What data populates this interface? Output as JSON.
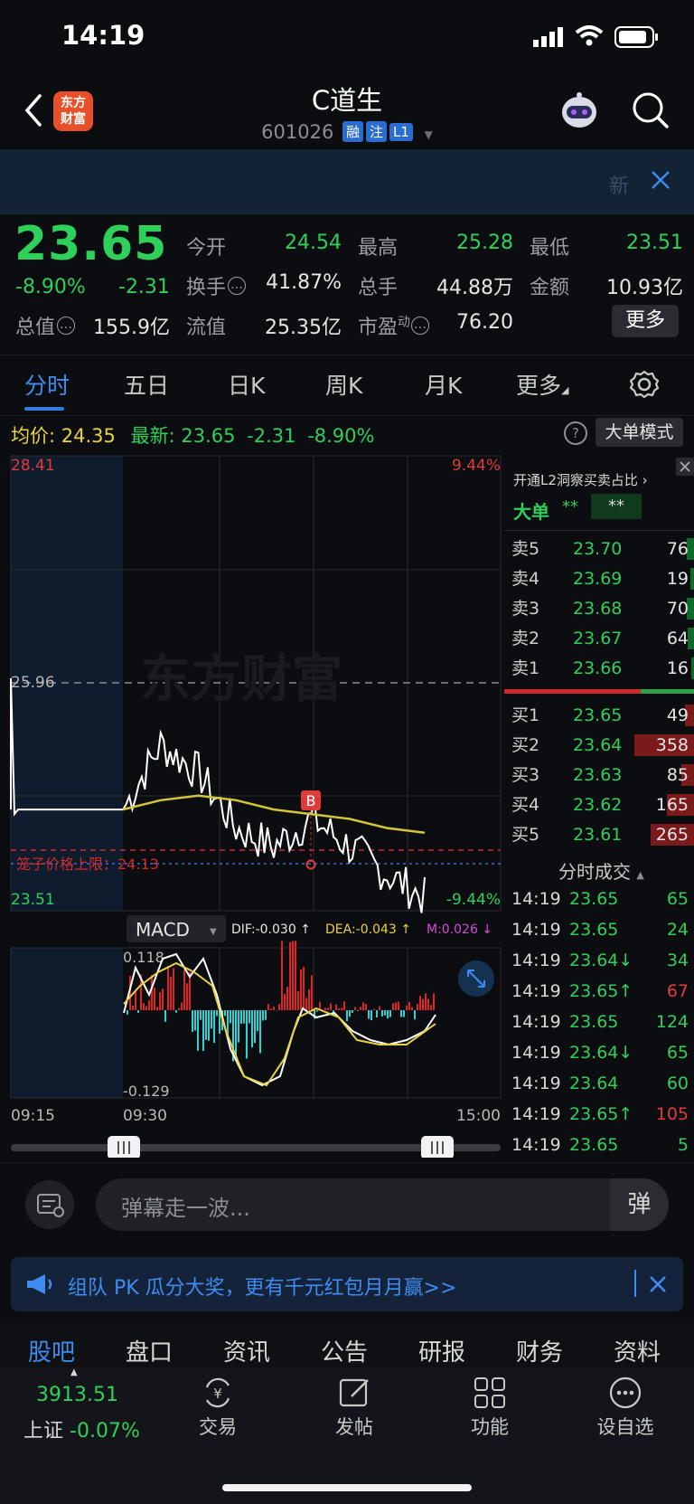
{
  "status_bar": {
    "time": "14:19"
  },
  "header": {
    "logo_text": "东方财富",
    "title": "C道生",
    "code": "601026",
    "tags": [
      "融",
      "注",
      "L1"
    ]
  },
  "banner": {
    "text": "新"
  },
  "quote": {
    "price": "23.65",
    "pct": "-8.90%",
    "change": "-2.31",
    "open_label": "今开",
    "open": "24.54",
    "high_label": "最高",
    "high": "25.28",
    "low_label": "最低",
    "low": "23.51",
    "turnover_label": "换手",
    "turnover": "41.87%",
    "volume_label": "总手",
    "volume": "44.88万",
    "amount_label": "金额",
    "amount": "10.93亿",
    "mktcap_label": "总值",
    "mktcap": "155.9亿",
    "float_label": "流值",
    "float": "25.35亿",
    "pe_label": "市盈",
    "pe_sup": "动",
    "pe": "76.20",
    "more": "更多"
  },
  "tabs": [
    "分时",
    "五日",
    "日K",
    "周K",
    "月K",
    "更多"
  ],
  "info": {
    "avg_label": "均价:",
    "avg": "24.35",
    "last_label": "最新:",
    "last": "23.65",
    "chg": "-2.31",
    "pct": "-8.90%",
    "big_mode": "大单模式",
    "help": "?"
  },
  "chart": {
    "y_max": "28.41",
    "y_mid": "25.96",
    "y_min": "23.51",
    "pct_max": "9.44%",
    "pct_min": "-9.44%",
    "watermark": "东方财富",
    "limit_label": "笼子价格上限：24.13",
    "marker": "B",
    "macd_label": "MACD",
    "dif": "DIF:-0.030 ↑",
    "dea": "DEA:-0.043 ↑",
    "m": "M:0.026 ↓",
    "macd_max": "0.118",
    "macd_min": "-0.129",
    "t_start": "09:15",
    "t_open": "09:30",
    "t_end": "15:00",
    "colors": {
      "price": "#ffffff",
      "avg": "#d4c43a",
      "up": "#e02424",
      "down": "#2ad4d4"
    }
  },
  "chart_data": {
    "type": "line",
    "x": [
      "09:30",
      "10:00",
      "10:30",
      "11:00",
      "11:30",
      "13:00",
      "13:30",
      "14:00",
      "14:19"
    ],
    "series": [
      {
        "name": "最新",
        "values": [
          24.6,
          25.3,
          25.0,
          24.4,
          24.2,
          24.5,
          24.2,
          23.9,
          23.65
        ]
      },
      {
        "name": "均价",
        "values": [
          24.6,
          24.7,
          24.75,
          24.7,
          24.6,
          24.55,
          24.5,
          24.4,
          24.35
        ]
      }
    ],
    "ylim": [
      23.51,
      28.41
    ]
  },
  "orderbook": {
    "l2_label": "开通L2洞察买卖占比",
    "big_label": "大单",
    "big_v1": "**",
    "big_v2": "**",
    "asks": [
      {
        "label": "卖5",
        "price": "23.70",
        "vol": "76"
      },
      {
        "label": "卖4",
        "price": "23.69",
        "vol": "19"
      },
      {
        "label": "卖3",
        "price": "23.68",
        "vol": "70"
      },
      {
        "label": "卖2",
        "price": "23.67",
        "vol": "64"
      },
      {
        "label": "卖1",
        "price": "23.66",
        "vol": "16"
      }
    ],
    "bids": [
      {
        "label": "买1",
        "price": "23.65",
        "vol": "49"
      },
      {
        "label": "买2",
        "price": "23.64",
        "vol": "358"
      },
      {
        "label": "买3",
        "price": "23.63",
        "vol": "85"
      },
      {
        "label": "买4",
        "price": "23.62",
        "vol": "165"
      },
      {
        "label": "买5",
        "price": "23.61",
        "vol": "265"
      }
    ],
    "ticks_title": "分时成交",
    "ticks": [
      {
        "time": "14:19",
        "price": "23.65",
        "vol": "65"
      },
      {
        "time": "14:19",
        "price": "23.65",
        "vol": "24"
      },
      {
        "time": "14:19",
        "price": "23.64↓",
        "vol": "34"
      },
      {
        "time": "14:19",
        "price": "23.65↑",
        "vol": "67"
      },
      {
        "time": "14:19",
        "price": "23.65",
        "vol": "124"
      },
      {
        "time": "14:19",
        "price": "23.64↓",
        "vol": "65"
      },
      {
        "time": "14:19",
        "price": "23.64",
        "vol": "60"
      },
      {
        "time": "14:19",
        "price": "23.65↑",
        "vol": "105"
      },
      {
        "time": "14:19",
        "price": "23.65",
        "vol": "5"
      }
    ]
  },
  "danmaku": {
    "placeholder": "弹幕走一波...",
    "send": "弹"
  },
  "promo": {
    "text": "组队 PK 瓜分大奖，更有千元红包月月赢>>"
  },
  "bottom_tabs": [
    "股吧",
    "盘口",
    "资讯",
    "公告",
    "研报",
    "财务",
    "资料"
  ],
  "nav": {
    "index_value": "3913.51",
    "index_name": "上证",
    "index_pct": "-0.07%",
    "trade": "交易",
    "post": "发帖",
    "func": "功能",
    "watch": "设自选"
  }
}
